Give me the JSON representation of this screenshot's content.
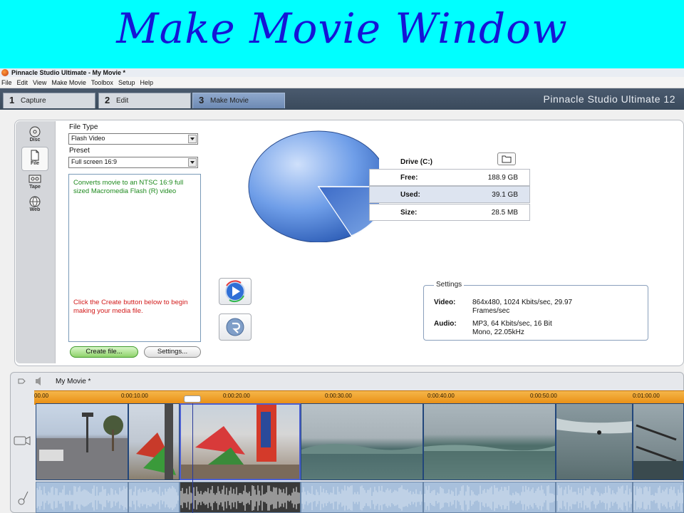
{
  "slide_title": "Make Movie Window",
  "window": {
    "title": "Pinnacle Studio Ultimate - My Movie *",
    "menu": [
      "File",
      "Edit",
      "View",
      "Make Movie",
      "Toolbox",
      "Setup",
      "Help"
    ],
    "brand": "Pinnacle Studio Ultimate 12"
  },
  "tabs": [
    {
      "num": "1",
      "label": "Capture",
      "active": false
    },
    {
      "num": "2",
      "label": "Edit",
      "active": false
    },
    {
      "num": "3",
      "label": "Make Movie",
      "active": true
    }
  ],
  "side_tabs": [
    {
      "label": "Disc",
      "icon": "disc-icon",
      "active": false
    },
    {
      "label": "File",
      "icon": "file-icon",
      "active": true
    },
    {
      "label": "Tape",
      "icon": "tape-icon",
      "active": false
    },
    {
      "label": "Web",
      "icon": "web-icon",
      "active": false
    }
  ],
  "file_type": {
    "label": "File Type",
    "value": "Flash Video"
  },
  "preset": {
    "label": "Preset",
    "value": "Full screen 16:9"
  },
  "description": {
    "green_text": "Converts movie to an NTSC 16:9 full sized Macromedia Flash (R) video",
    "red_text": "Click the Create button below to begin making your media file."
  },
  "buttons": {
    "create": "Create file...",
    "settings": "Settings..."
  },
  "drive": {
    "label": "Drive (C:)",
    "used_fraction": 0.172,
    "rows": [
      {
        "key": "Free:",
        "value": "188.9 GB",
        "selected": false
      },
      {
        "key": "Used:",
        "value": "39.1 GB",
        "selected": true
      },
      {
        "key": "Size:",
        "value": "28.5 MB",
        "selected": false
      }
    ]
  },
  "settings": {
    "legend": "Settings",
    "video_key": "Video:",
    "video_line1": "864x480, 1024 Kbits/sec, 29.97",
    "video_line2": "Frames/sec",
    "audio_key": "Audio:",
    "audio_line1": "MP3, 64 Kbits/sec, 16 Bit",
    "audio_line2": "Mono, 22.05kHz"
  },
  "timeline": {
    "movie_name": "My Movie *",
    "ticks": [
      "00.00",
      "0:00:10.00",
      "0:00:20.00",
      "0:00:30.00",
      "0:00:40.00",
      "0:00:50.00",
      "0:01:00.00"
    ]
  },
  "colors": {
    "banner": "#00ffff",
    "title": "#1515d6",
    "ruler": "#f0a030",
    "pie": "#6f9ee8"
  }
}
